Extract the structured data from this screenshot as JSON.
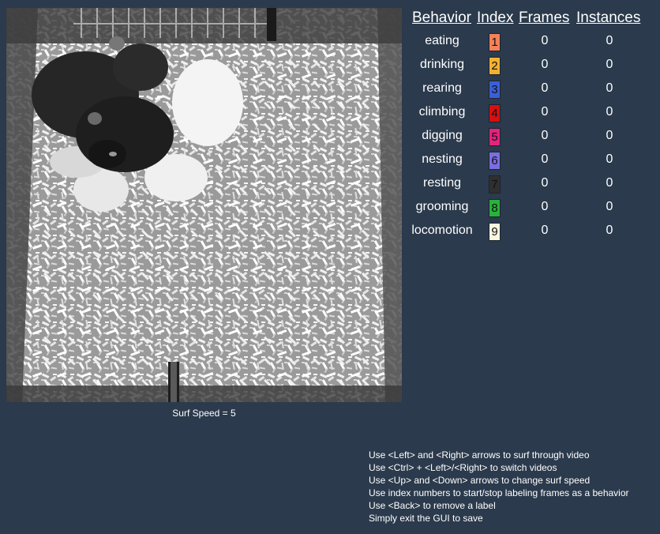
{
  "video": {
    "surf_speed_text": "Surf Speed = 5"
  },
  "table": {
    "headers": {
      "behavior": "Behavior",
      "index": "Index",
      "frames": "Frames",
      "instances": "Instances"
    },
    "rows": [
      {
        "behavior": "eating",
        "index": "1",
        "frames": "0",
        "instances": "0",
        "color": "#f4815a"
      },
      {
        "behavior": "drinking",
        "index": "2",
        "frames": "0",
        "instances": "0",
        "color": "#f3b132"
      },
      {
        "behavior": "rearing",
        "index": "3",
        "frames": "0",
        "instances": "0",
        "color": "#3b5fd8"
      },
      {
        "behavior": "climbing",
        "index": "4",
        "frames": "0",
        "instances": "0",
        "color": "#d80f0f"
      },
      {
        "behavior": "digging",
        "index": "5",
        "frames": "0",
        "instances": "0",
        "color": "#e4237f"
      },
      {
        "behavior": "nesting",
        "index": "6",
        "frames": "0",
        "instances": "0",
        "color": "#7a6ee0"
      },
      {
        "behavior": "resting",
        "index": "7",
        "frames": "0",
        "instances": "0",
        "color": "#2f2f2f"
      },
      {
        "behavior": "grooming",
        "index": "8",
        "frames": "0",
        "instances": "0",
        "color": "#27b33a"
      },
      {
        "behavior": "locomotion",
        "index": "9",
        "frames": "0",
        "instances": "0",
        "color": "#fff6df"
      }
    ]
  },
  "help": {
    "lines": [
      "Use <Left> and <Right> arrows to surf through video",
      "Use <Ctrl> + <Left>/<Right> to switch videos",
      "Use <Up> and <Down> arrows to change surf speed",
      "Use index numbers to start/stop labeling frames as a behavior",
      "Use <Back> to remove a label",
      "Simply exit the GUI to save"
    ]
  }
}
